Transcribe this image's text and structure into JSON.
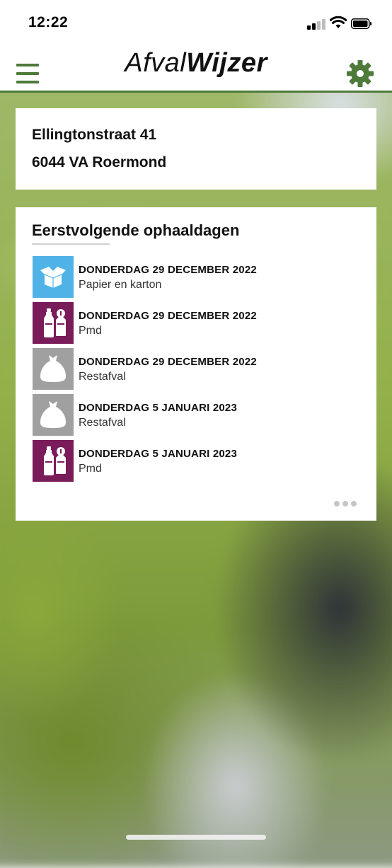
{
  "status_bar": {
    "time": "12:22"
  },
  "header": {
    "logo_part1": "Afval",
    "logo_part2": "Wijzer",
    "menu_icon": "hamburger-menu-icon",
    "settings_icon": "gear-icon"
  },
  "address": {
    "street": "Ellingtonstraat 41",
    "city": "6044 VA Roermond"
  },
  "pickups": {
    "title": "Eerstvolgende ophaaldagen",
    "items": [
      {
        "date": "DONDERDAG 29 DECEMBER 2022",
        "type": "Papier en karton",
        "icon": "paper-box-icon",
        "color": "#4fb3e8"
      },
      {
        "date": "DONDERDAG 29 DECEMBER 2022",
        "type": "Pmd",
        "icon": "pmd-bottle-icon",
        "color": "#7a1b5a"
      },
      {
        "date": "DONDERDAG 29 DECEMBER 2022",
        "type": "Restafval",
        "icon": "trash-bag-icon",
        "color": "#a0a0a0"
      },
      {
        "date": "DONDERDAG 5 JANUARI 2023",
        "type": "Restafval",
        "icon": "trash-bag-icon",
        "color": "#a0a0a0"
      },
      {
        "date": "DONDERDAG 5 JANUARI 2023",
        "type": "Pmd",
        "icon": "pmd-bottle-icon",
        "color": "#7a1b5a"
      }
    ],
    "more_icon": "more-dots-icon"
  },
  "colors": {
    "brand_green": "#4e7a3a"
  }
}
